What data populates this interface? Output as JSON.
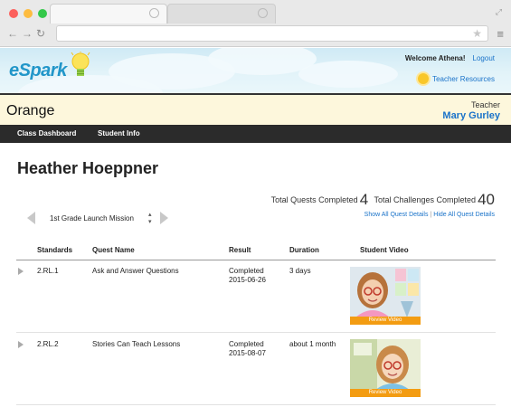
{
  "banner": {
    "logo_text": "eSpark",
    "welcome": "Welcome Athena!",
    "logout": "Logout",
    "teacher_resources": "Teacher Resources"
  },
  "class": {
    "name": "Orange",
    "teacher_label": "Teacher",
    "teacher_name": "Mary Gurley"
  },
  "nav": {
    "items": [
      {
        "label": "Class Dashboard"
      },
      {
        "label": "Student Info"
      }
    ]
  },
  "student": {
    "name": "Heather Hoeppner"
  },
  "totals": {
    "quests_label": "Total Quests Completed",
    "quests_value": "4",
    "challenges_label": "Total Challenges Completed",
    "challenges_value": "40",
    "show_all": "Show All Quest Details",
    "separator": "|",
    "hide_all": "Hide All Quest Details"
  },
  "mission": {
    "selected": "1st Grade Launch Mission"
  },
  "table": {
    "headers": [
      "Standards",
      "Quest Name",
      "Result",
      "Duration",
      "Student Video"
    ],
    "rows": [
      {
        "standard": "2.RL.1",
        "quest": "Ask and Answer Questions",
        "result": "Completed",
        "date": "2015-06-26",
        "duration": "3 days",
        "video_button": "Review Video"
      },
      {
        "standard": "2.RL.2",
        "quest": "Stories Can Teach Lessons",
        "result": "Completed",
        "date": "2015-08-07",
        "duration": "about 1 month",
        "video_button": "Review Video"
      }
    ]
  },
  "colors": {
    "accent_blue": "#1a73c9",
    "nav_bg": "#2b2b2b",
    "class_bar_bg": "#fdf7dc",
    "video_button": "#f39c12"
  }
}
